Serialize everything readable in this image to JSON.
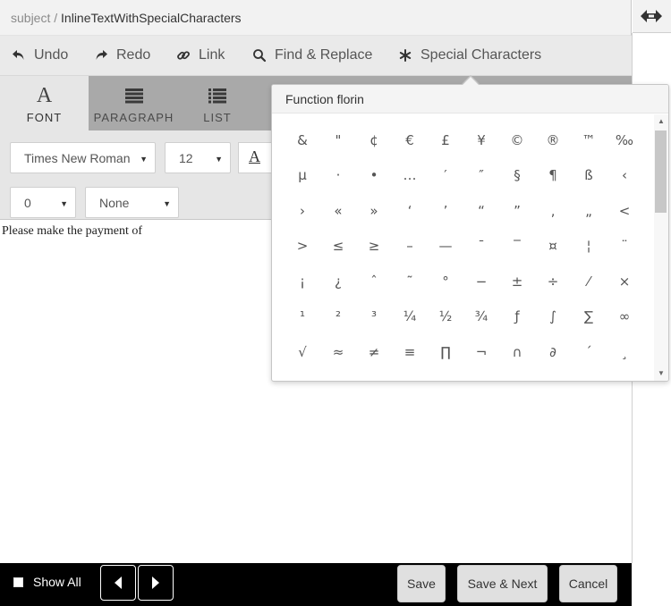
{
  "breadcrumb": {
    "root": "subject",
    "separator": " / ",
    "item": "InlineTextWithSpecialCharacters"
  },
  "toolbar": {
    "undo": "Undo",
    "redo": "Redo",
    "link": "Link",
    "find_replace": "Find & Replace",
    "special_characters": "Special Characters"
  },
  "ribbon": {
    "tabs": [
      {
        "label": "FONT",
        "active": true
      },
      {
        "label": "PARAGRAPH",
        "active": false
      },
      {
        "label": "LIST",
        "active": false
      }
    ],
    "font_family": "Times New Roman",
    "font_size": "12",
    "color_button_glyph": "A",
    "spacing": "0",
    "effect": "None"
  },
  "editor": {
    "text": "Please make the payment of"
  },
  "popup": {
    "title": "Function florin",
    "characters": [
      [
        "&",
        "\"",
        "¢",
        "€",
        "£",
        "¥",
        "©",
        "®",
        "™",
        "‰"
      ],
      [
        "µ",
        "·",
        "•",
        "…",
        "′",
        "″",
        "§",
        "¶",
        "ß",
        "‹"
      ],
      [
        "›",
        "«",
        "»",
        "‘",
        "’",
        "“",
        "”",
        "‚",
        "„",
        "<"
      ],
      [
        ">",
        "≤",
        "≥",
        "–",
        "—",
        "¯",
        "‾",
        "¤",
        "¦",
        "¨"
      ],
      [
        "¡",
        "¿",
        "ˆ",
        "˜",
        "°",
        "−",
        "±",
        "÷",
        "⁄",
        "×"
      ],
      [
        "¹",
        "²",
        "³",
        "¼",
        "½",
        "¾",
        "ƒ",
        "∫",
        "∑",
        "∞"
      ],
      [
        "√",
        "≈",
        "≠",
        "≡",
        "∏",
        "¬",
        "∩",
        "∂",
        "´",
        "¸"
      ]
    ]
  },
  "footer": {
    "show_all": "Show All",
    "save": "Save",
    "save_next": "Save & Next",
    "cancel": "Cancel"
  }
}
